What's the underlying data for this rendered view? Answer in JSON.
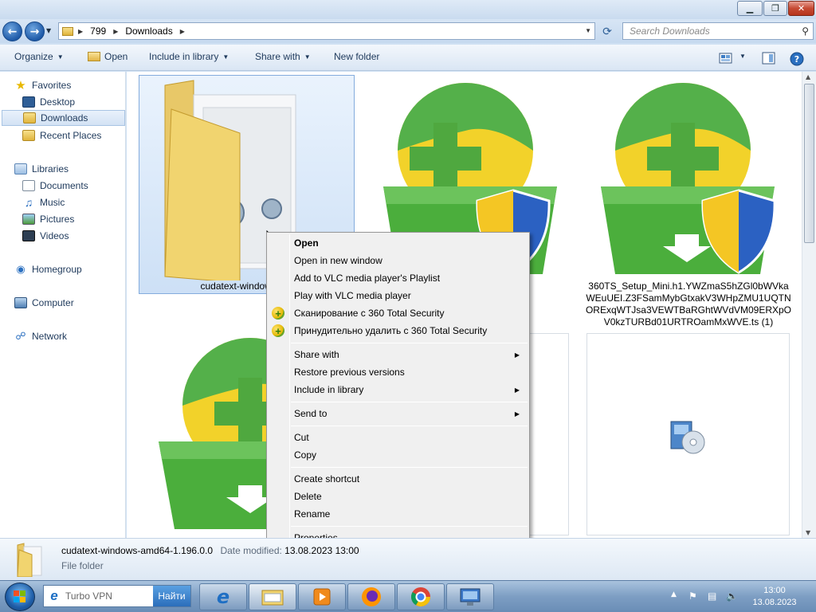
{
  "window": {
    "minimize_glyph": "▁",
    "maximize_glyph": "❐",
    "close_glyph": "✕"
  },
  "address": {
    "crumbs": [
      "799",
      "Downloads"
    ],
    "search_placeholder": "Search Downloads"
  },
  "toolbar": {
    "organize": "Organize",
    "open": "Open",
    "include_in_library": "Include in library",
    "share_with": "Share with",
    "new_folder": "New folder"
  },
  "nav": {
    "favorites": "Favorites",
    "desktop": "Desktop",
    "downloads": "Downloads",
    "recent_places": "Recent Places",
    "libraries": "Libraries",
    "documents": "Documents",
    "music": "Music",
    "pictures": "Pictures",
    "videos": "Videos",
    "homegroup": "Homegroup",
    "computer": "Computer",
    "network": "Network"
  },
  "files": {
    "folder_label": "cudatext-windows-am",
    "installer_label": "360TS_Setup_Mini.h1.YWZmaS5hZGl0bWVkaWEuUEI.Z3FSamMybGtxakV3WHpZMU1UQTNORExqWTJsa3VEWTBaRGhtWVdVM09ERXpOV0kzTURBd01URTROamMxWVE.ts (1)"
  },
  "context_menu": {
    "open": "Open",
    "open_new_window": "Open in new window",
    "vlc_playlist": "Add to VLC media player's Playlist",
    "vlc_play": "Play with VLC media player",
    "scan_360": "Сканирование с 360 Total Security",
    "force_delete_360": "Принудительно удалить с  360 Total Security",
    "share_with": "Share with",
    "restore_previous": "Restore previous versions",
    "include_in_library": "Include in library",
    "send_to": "Send to",
    "cut": "Cut",
    "copy": "Copy",
    "create_shortcut": "Create shortcut",
    "delete": "Delete",
    "rename": "Rename",
    "properties": "Properties"
  },
  "details": {
    "name": "cudatext-windows-amd64-1.196.0.0",
    "modified_label": "Date modified:",
    "modified_value": "13.08.2023 13:00",
    "type": "File folder"
  },
  "taskbar": {
    "search_text": "Turbo VPN",
    "search_button": "Найти",
    "time": "13:00",
    "date": "13.08.2023"
  }
}
